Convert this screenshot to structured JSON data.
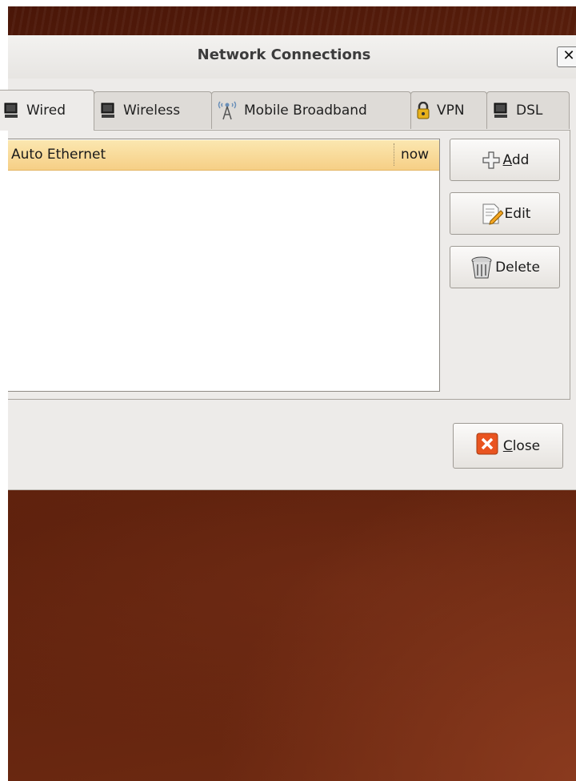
{
  "window": {
    "title": "Network Connections",
    "close_glyph": "✕"
  },
  "tabs": [
    {
      "label": "Wired",
      "icon": "monitor-icon",
      "active": true
    },
    {
      "label": "Wireless",
      "icon": "monitor-icon",
      "active": false
    },
    {
      "label": "Mobile Broadband",
      "icon": "antenna-icon",
      "active": false
    },
    {
      "label": "VPN",
      "icon": "lock-icon",
      "active": false
    },
    {
      "label": "DSL",
      "icon": "monitor-icon",
      "active": false
    }
  ],
  "connections": [
    {
      "name": "Auto Ethernet",
      "last_used": "now",
      "selected": true
    }
  ],
  "buttons": {
    "add": {
      "mnemonic": "A",
      "rest": "dd"
    },
    "edit": {
      "label": "Edit"
    },
    "delete": {
      "label": "Delete"
    },
    "close": {
      "mnemonic": "C",
      "rest": "lose"
    }
  },
  "colors": {
    "selection": "#f6cf86",
    "close_icon": "#e95420"
  }
}
